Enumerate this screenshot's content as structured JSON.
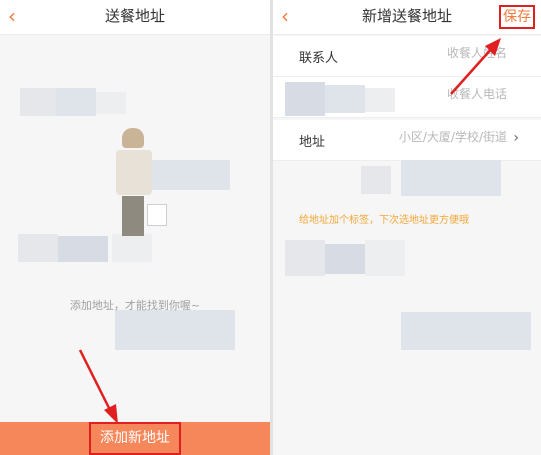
{
  "left_screen": {
    "back_icon": "chevron-left-icon",
    "title": "送餐地址",
    "empty_message": "添加地址，才能找到你喔~",
    "add_button_label": "添加新地址"
  },
  "right_screen": {
    "back_icon": "chevron-left-icon",
    "title": "新增送餐地址",
    "save_label": "保存",
    "form": {
      "contact": {
        "label": "联系人",
        "placeholder": "收餐人姓名"
      },
      "phone": {
        "label": "",
        "placeholder": "收餐人电话"
      },
      "address": {
        "label": "地址",
        "placeholder": "小区/大厦/学校/街道"
      }
    },
    "tag_hint": "给地址加个标签，下次选地址更方便哦"
  },
  "annotation_color": "#e02020",
  "accent_color": "#f07b3f"
}
